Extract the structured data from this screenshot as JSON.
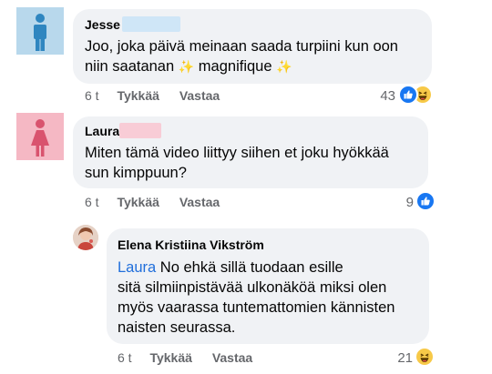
{
  "comments": [
    {
      "author": "Jesse",
      "avatar": "male-silhouette-icon",
      "avatar_bg": "#b8d8ec",
      "avatar_fg": "#2f86c0",
      "lines": [
        "Joo, joka päivä meinaan saada turpiini kun oon",
        "niin saatanan",
        "magnifique"
      ],
      "emoji": "sparkles-icon",
      "time": "6 t",
      "like": "Tykkää",
      "reply": "Vastaa",
      "count": "43",
      "reactions": [
        "like",
        "haha"
      ]
    },
    {
      "author": "Laura",
      "avatar": "female-silhouette-icon",
      "avatar_bg": "#f5b8c4",
      "avatar_fg": "#d9536e",
      "lines": [
        "Miten tämä video liittyy siihen et joku hyökkää",
        "sun kimppuun?"
      ],
      "time": "6 t",
      "like": "Tykkää",
      "reply": "Vastaa",
      "count": "9",
      "reactions": [
        "like"
      ]
    },
    {
      "author": "Elena Kristiina Vikström",
      "avatar": "profile-photo",
      "mention": "Laura",
      "lines": [
        "No ehkä sillä tuodaan esille",
        "sitä silmiinpistävää ulkonäköä miksi olen",
        "myös vaarassa tuntemattomien kännisten",
        "naisten seurassa."
      ],
      "time": "6 t",
      "like": "Tykkää",
      "reply": "Vastaa",
      "count": "21",
      "reactions": [
        "haha"
      ]
    }
  ],
  "colors": {
    "bubble": "#f0f2f5",
    "redact_blue": "#cfe6f7",
    "redact_pink": "#f8ccd6",
    "like_blue": "#1877f2",
    "haha_yellow": "#f7c948",
    "mention": "#216fdb"
  }
}
